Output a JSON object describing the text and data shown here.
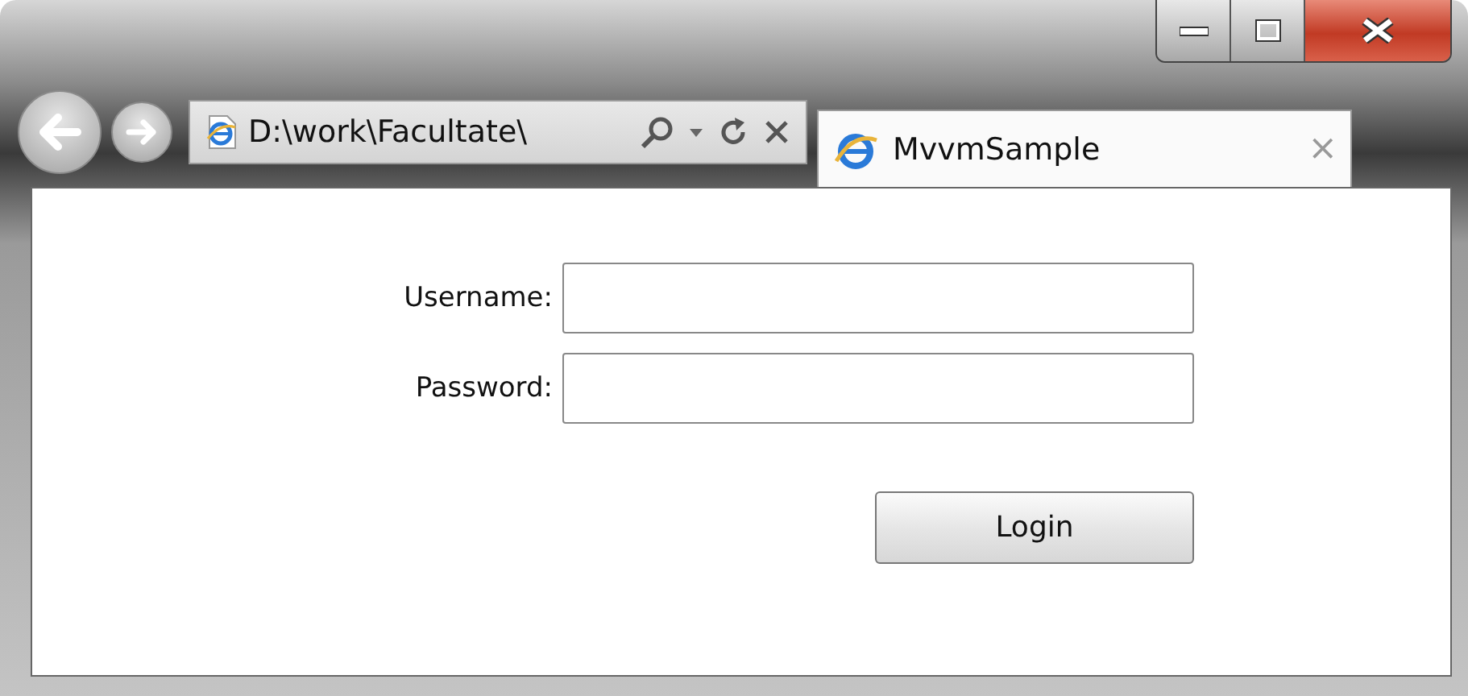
{
  "browser": {
    "address": "D:\\work\\Facultate\\",
    "tabs": [
      {
        "title": "MvvmSample",
        "selected": true,
        "close": "×"
      }
    ]
  },
  "form": {
    "fields": [
      {
        "label": "Username:"
      },
      {
        "label": "Password:"
      }
    ],
    "button": "Login"
  }
}
